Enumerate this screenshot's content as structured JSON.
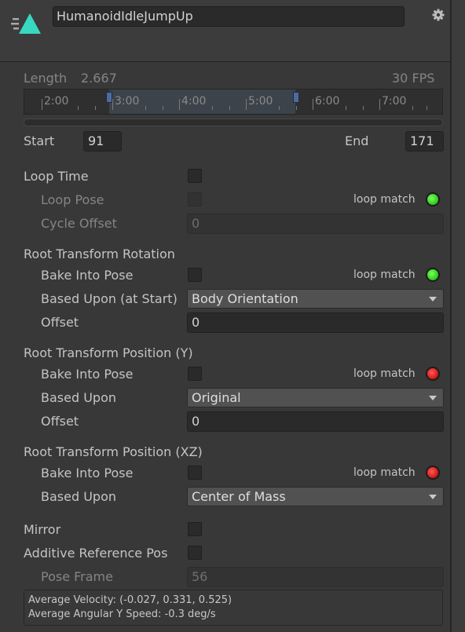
{
  "header": {
    "clip_name": "HumanoidIdleJumpUp"
  },
  "length": {
    "label": "Length",
    "value": "2.667",
    "fps": "30 FPS"
  },
  "timeline": {
    "ticks": [
      "2:00",
      "3:00",
      "4:00",
      "5:00",
      "6:00",
      "7:00"
    ]
  },
  "range": {
    "start_label": "Start",
    "start_value": "91",
    "end_label": "End",
    "end_value": "171"
  },
  "loop": {
    "loop_time_label": "Loop Time",
    "loop_pose_label": "Loop Pose",
    "loop_match_label": "loop match",
    "cycle_offset_label": "Cycle Offset",
    "cycle_offset_value": "0",
    "loop_match_color": "#2fd41f"
  },
  "root_rotation": {
    "title": "Root Transform Rotation",
    "bake_label": "Bake Into Pose",
    "loop_match_label": "loop match",
    "based_upon_label": "Based Upon (at Start)",
    "based_upon_value": "Body Orientation",
    "offset_label": "Offset",
    "offset_value": "0",
    "loop_match_color": "#2fd41f"
  },
  "root_position_y": {
    "title": "Root Transform Position (Y)",
    "bake_label": "Bake Into Pose",
    "loop_match_label": "loop match",
    "based_upon_label": "Based Upon",
    "based_upon_value": "Original",
    "offset_label": "Offset",
    "offset_value": "0",
    "loop_match_color": "#d81a1a"
  },
  "root_position_xz": {
    "title": "Root Transform Position (XZ)",
    "bake_label": "Bake Into Pose",
    "loop_match_label": "loop match",
    "based_upon_label": "Based Upon",
    "based_upon_value": "Center of Mass",
    "loop_match_color": "#d81a1a"
  },
  "misc": {
    "mirror_label": "Mirror",
    "additive_label": "Additive Reference Pos",
    "pose_frame_label": "Pose Frame",
    "pose_frame_value": "56"
  },
  "info": {
    "avg_velocity": "Average Velocity: (-0.027, 0.331, 0.525)",
    "avg_angular": "Average Angular Y Speed: -0.3 deg/s"
  },
  "icons": {
    "clip_icon": "animation-clip-icon",
    "settings_icon": "gear-icon"
  }
}
